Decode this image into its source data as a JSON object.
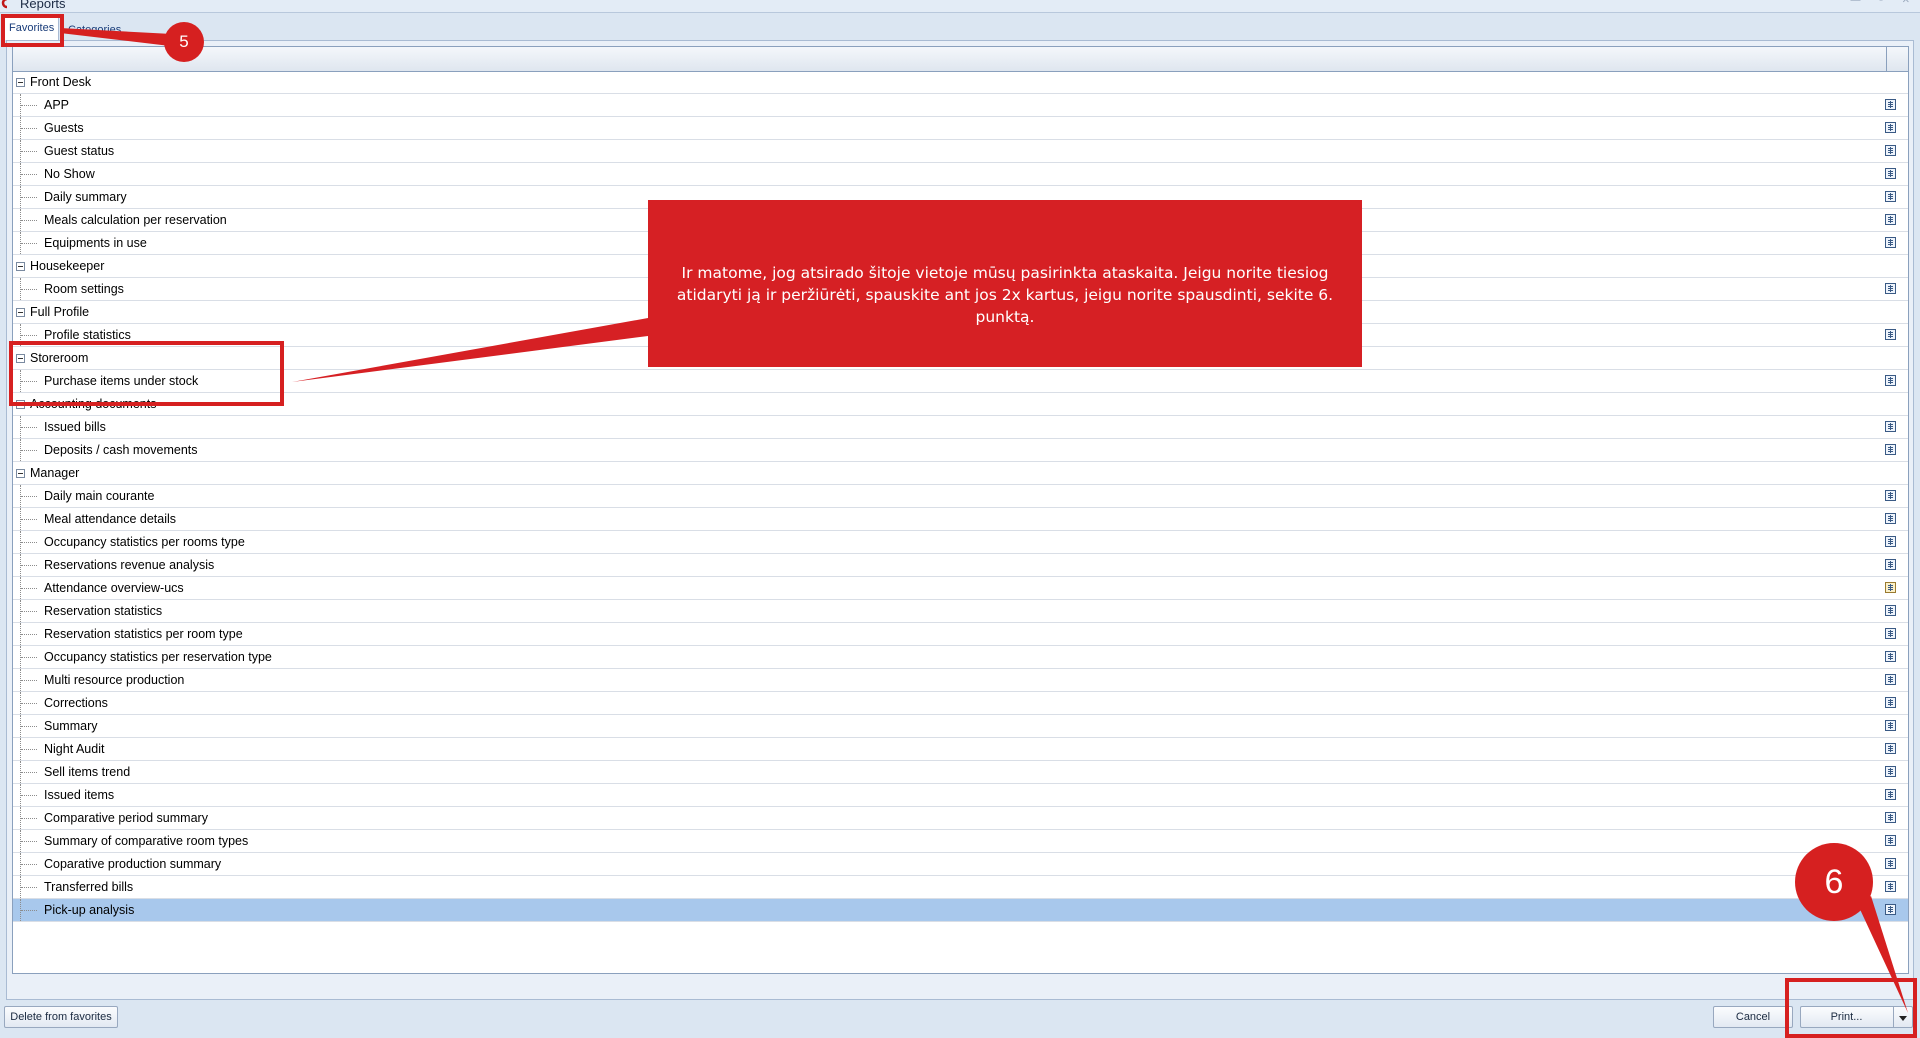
{
  "window": {
    "title": "Reports",
    "controls": "— ▫ ✕"
  },
  "tabs": [
    {
      "label": "Favorites"
    },
    {
      "label": "Categories"
    }
  ],
  "tree": [
    {
      "label": "Front Desk",
      "type": "group"
    },
    {
      "label": "APP",
      "type": "item"
    },
    {
      "label": "Guests",
      "type": "item"
    },
    {
      "label": "Guest status",
      "type": "item"
    },
    {
      "label": "No Show",
      "type": "item"
    },
    {
      "label": "Daily summary",
      "type": "item"
    },
    {
      "label": "Meals calculation per reservation",
      "type": "item"
    },
    {
      "label": "Equipments in use",
      "type": "item"
    },
    {
      "label": "Housekeeper",
      "type": "group"
    },
    {
      "label": "Room settings",
      "type": "item"
    },
    {
      "label": "Full Profile",
      "type": "group"
    },
    {
      "label": "Profile statistics",
      "type": "item"
    },
    {
      "label": "Storeroom",
      "type": "group"
    },
    {
      "label": "Purchase items under stock",
      "type": "item"
    },
    {
      "label": "Accounting documents",
      "type": "group"
    },
    {
      "label": "Issued bills",
      "type": "item"
    },
    {
      "label": "Deposits / cash movements",
      "type": "item"
    },
    {
      "label": "Manager",
      "type": "group"
    },
    {
      "label": "Daily main courante",
      "type": "item"
    },
    {
      "label": "Meal attendance details",
      "type": "item"
    },
    {
      "label": "Occupancy statistics per rooms type",
      "type": "item"
    },
    {
      "label": "Reservations revenue analysis",
      "type": "item"
    },
    {
      "label": "Attendance overview-ucs",
      "type": "item",
      "icon": "report-yellow"
    },
    {
      "label": "Reservation statistics",
      "type": "item"
    },
    {
      "label": "Reservation statistics per room type",
      "type": "item"
    },
    {
      "label": "Occupancy statistics  per  reservation type",
      "type": "item"
    },
    {
      "label": "Multi resource production",
      "type": "item"
    },
    {
      "label": "Corrections",
      "type": "item"
    },
    {
      "label": "Summary",
      "type": "item"
    },
    {
      "label": "Night Audit",
      "type": "item"
    },
    {
      "label": "Sell items trend",
      "type": "item"
    },
    {
      "label": "Issued items",
      "type": "item"
    },
    {
      "label": "Comparative period summary",
      "type": "item"
    },
    {
      "label": "Summary of comparative room types",
      "type": "item"
    },
    {
      "label": "Coparative production summary",
      "type": "item"
    },
    {
      "label": "Transferred bills",
      "type": "item"
    },
    {
      "label": "Pick-up analysis",
      "type": "item",
      "selected": true
    }
  ],
  "buttons": {
    "delete": "Delete from favorites",
    "cancel": "Cancel",
    "print": "Print..."
  },
  "annotations": {
    "step5": "5",
    "step6": "6",
    "callout": "Ir matome, jog atsirado šitoje vietoje mūsų pasirinkta ataskaita. Jeigu norite tiesiog atidaryti ją ir peržiūrėti, spauskite ant jos 2x kartus, jeigu norite spausdinti, sekite 6. punktą."
  },
  "colors": {
    "annotation_red": "#d62020",
    "selection": "#a8c8ec",
    "background": "#dbe6f2"
  }
}
